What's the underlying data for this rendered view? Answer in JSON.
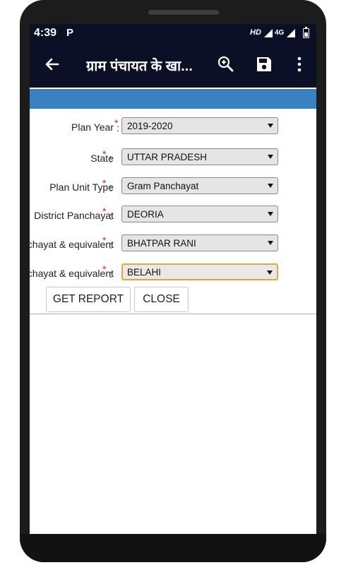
{
  "status_bar": {
    "time": "4:39",
    "notification_icon": "P",
    "hd": "HD",
    "network": "4G"
  },
  "app_bar": {
    "title": "ग्राम पंचायत के खा..."
  },
  "form": {
    "rows": [
      {
        "label": "Plan Year",
        "value": "2019-2020"
      },
      {
        "label": "State",
        "value": "UTTAR PRADESH"
      },
      {
        "label": "Plan Unit Type",
        "value": "Gram Panchayat"
      },
      {
        "label": "District Panchayat",
        "value": "DEORIA"
      },
      {
        "label": "Block Panchayat & equivalent",
        "value": "BHATPAR RANI"
      },
      {
        "label": "Gram Panchayat & equivalent",
        "value": "BELAHI"
      }
    ],
    "required_mark": "*",
    "colon": ":"
  },
  "buttons": {
    "get_report": "GET REPORT",
    "close": "CLOSE"
  },
  "colors": {
    "app_bar": "#0b1026",
    "band": "#3a80c2",
    "required": "#e02020",
    "focus": "#e4a83a"
  },
  "icons": [
    "back-arrow-icon",
    "zoom-in-icon",
    "save-icon",
    "more-vert-icon",
    "caret-down-icon"
  ]
}
